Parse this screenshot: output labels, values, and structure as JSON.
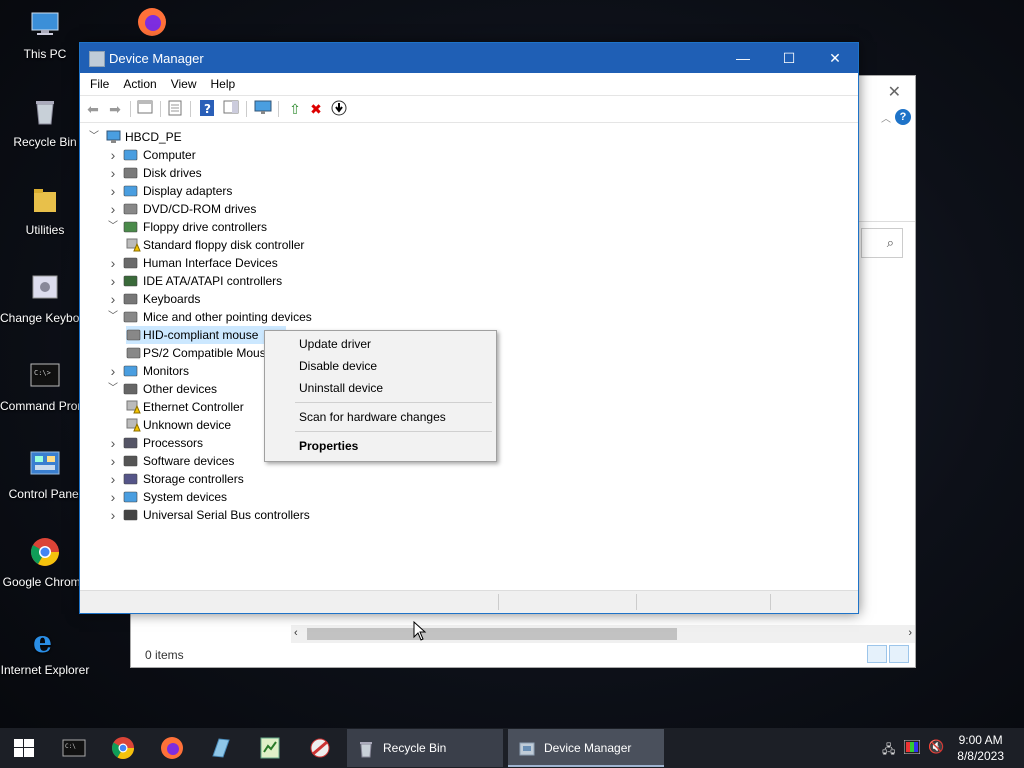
{
  "desktop": {
    "icons": [
      {
        "label": "This PC"
      },
      {
        "label": "Recycle Bin"
      },
      {
        "label": "Utilities"
      },
      {
        "label": "Change Keyboard Layout"
      },
      {
        "label": "Command Prompt"
      },
      {
        "label": "Control Panel"
      },
      {
        "label": "Google Chrome"
      },
      {
        "label": "Internet Explorer"
      }
    ]
  },
  "explorer": {
    "status_text": "0 items"
  },
  "device_manager": {
    "title": "Device Manager",
    "menu": [
      "File",
      "Action",
      "View",
      "Help"
    ],
    "tree": {
      "root": "HBCD_PE",
      "items": [
        {
          "label": "Computer",
          "expanded": false
        },
        {
          "label": "Disk drives",
          "expanded": false
        },
        {
          "label": "Display adapters",
          "expanded": false
        },
        {
          "label": "DVD/CD-ROM drives",
          "expanded": false
        },
        {
          "label": "Floppy drive controllers",
          "expanded": true
        },
        {
          "label": "Standard floppy disk controller",
          "child": true,
          "warning": true
        },
        {
          "label": "Human Interface Devices",
          "expanded": false
        },
        {
          "label": "IDE ATA/ATAPI controllers",
          "expanded": false
        },
        {
          "label": "Keyboards",
          "expanded": false
        },
        {
          "label": "Mice and other pointing devices",
          "expanded": true
        },
        {
          "label": "HID-compliant mouse",
          "child": true,
          "selected": true
        },
        {
          "label": "PS/2 Compatible Mouse",
          "child": true
        },
        {
          "label": "Monitors",
          "expanded": false
        },
        {
          "label": "Other devices",
          "expanded": true
        },
        {
          "label": "Ethernet Controller",
          "child": true,
          "warning": true
        },
        {
          "label": "Unknown device",
          "child": true,
          "warning": true
        },
        {
          "label": "Processors",
          "expanded": false
        },
        {
          "label": "Software devices",
          "expanded": false
        },
        {
          "label": "Storage controllers",
          "expanded": false
        },
        {
          "label": "System devices",
          "expanded": false
        },
        {
          "label": "Universal Serial Bus controllers",
          "expanded": false
        }
      ]
    }
  },
  "context_menu": {
    "items": [
      "Update driver",
      "Disable device",
      "Uninstall device",
      "Scan for hardware changes",
      "Properties"
    ]
  },
  "taskbar": {
    "tasks": [
      {
        "label": "Recycle Bin"
      },
      {
        "label": "Device Manager"
      }
    ],
    "time": "9:00 AM",
    "date": "8/8/2023"
  }
}
